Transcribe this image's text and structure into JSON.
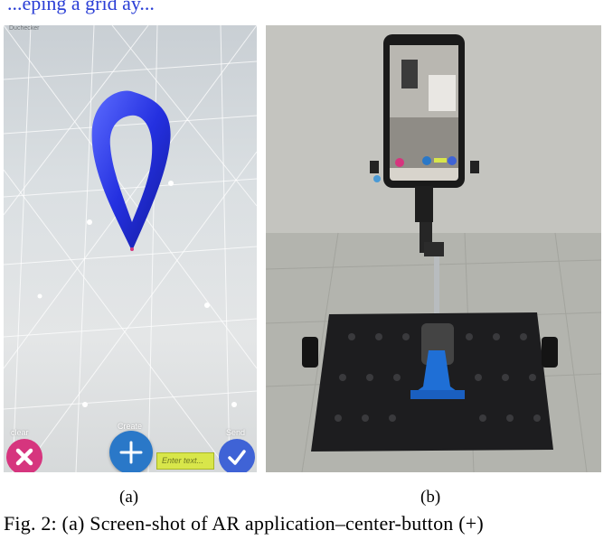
{
  "top_text": "...eping a grid ay...",
  "panel_a": {
    "status_mark": "Duchecker",
    "clear_label": "clear",
    "create_label": "Create",
    "send_label": "Send",
    "input_placeholder": "Enter text...",
    "pin_color": "#2430e0",
    "clear_color": "#d6357e",
    "create_color": "#2a78c8",
    "send_color": "#3f63d6"
  },
  "captions": {
    "a": "(a)",
    "b": "(b)",
    "figure": "Fig. 2: (a) Screen-shot of AR application–center-button (+)"
  }
}
